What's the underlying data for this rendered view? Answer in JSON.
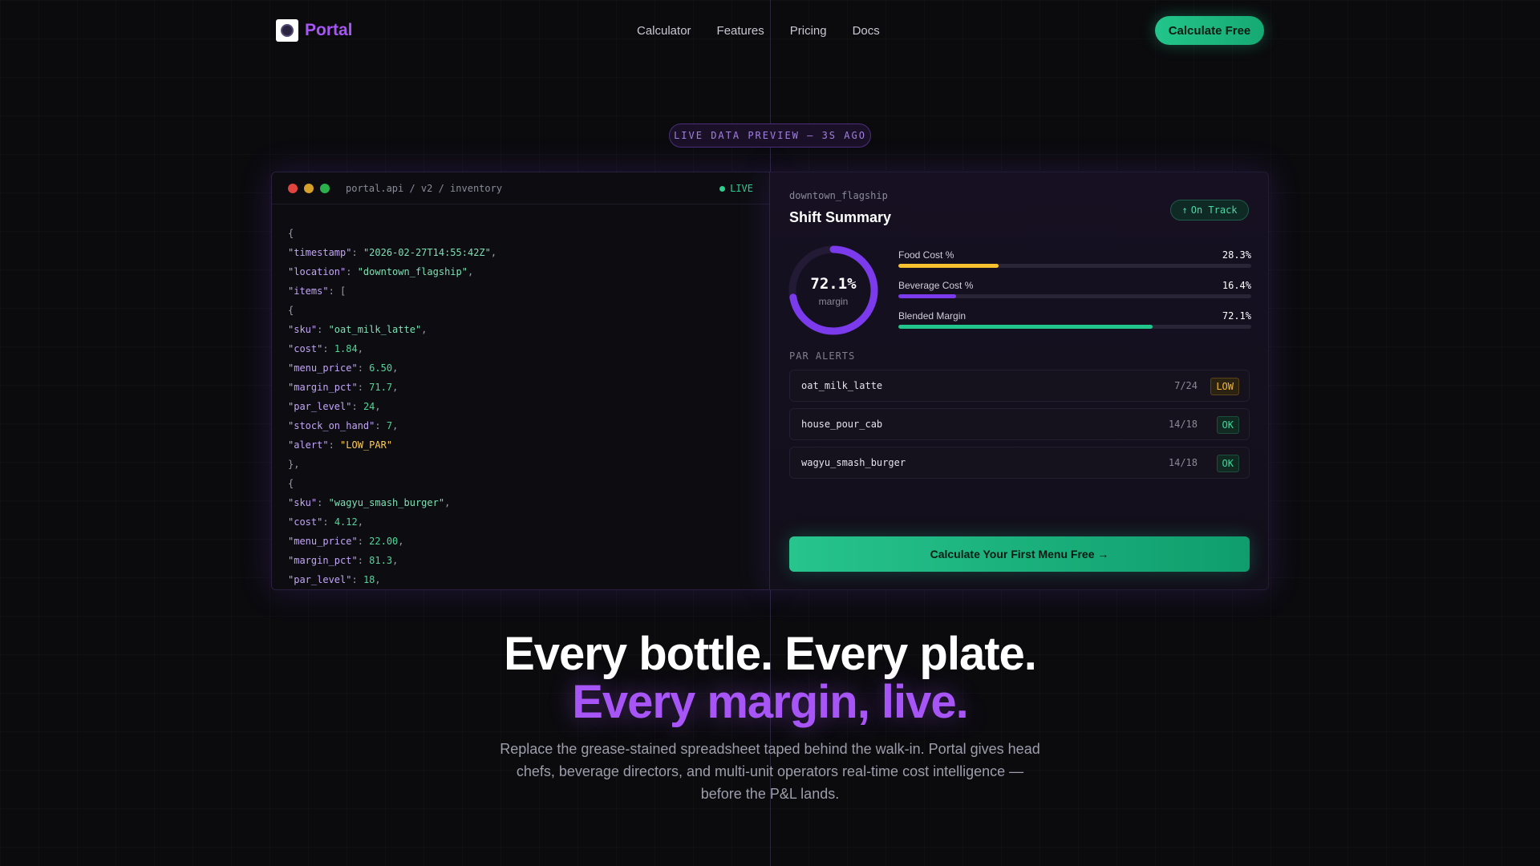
{
  "brand": {
    "name": "Portal"
  },
  "nav": {
    "links": [
      "Calculator",
      "Features",
      "Pricing",
      "Docs"
    ],
    "cta": "Calculate Free"
  },
  "badge": "LIVE DATA PREVIEW — 3S AGO",
  "code_panel": {
    "path": "portal.api / v2 / inventory",
    "live_label": "LIVE",
    "lines": {
      "open": "{",
      "timestamp_key": "\"timestamp\"",
      "timestamp_val": "\"2026-02-27T14:55:42Z\"",
      "location_key": "\"location\"",
      "location_val": "\"downtown_flagship\"",
      "items_key": "\"items\"",
      "item1": {
        "sku": "\"oat_milk_latte\"",
        "cost": "1.84",
        "menu_price": "6.50",
        "margin_pct": "71.7",
        "par_level": "24",
        "stock_on_hand": "7",
        "alert": "\"LOW_PAR\""
      },
      "item2": {
        "sku": "\"wagyu_smash_burger\"",
        "cost": "4.12",
        "menu_price": "22.00",
        "margin_pct": "81.3",
        "par_level": "18"
      }
    }
  },
  "summary": {
    "location": "downtown_flagship",
    "title": "Shift Summary",
    "status": "On Track",
    "status_icon": "arrow-up-icon",
    "ring": {
      "value_label": "72.1%",
      "value": 72.1,
      "label": "margin",
      "color": "#7c3aed"
    },
    "metrics": [
      {
        "label": "Food Cost %",
        "value_label": "28.3%",
        "value": 28.3,
        "color": "#f5c12e"
      },
      {
        "label": "Beverage Cost %",
        "value_label": "16.4%",
        "value": 16.4,
        "color": "#7c3aed"
      },
      {
        "label": "Blended Margin",
        "value_label": "72.1%",
        "value": 72.1,
        "color": "#22c58b"
      }
    ],
    "par_title": "PAR ALERTS",
    "alerts": [
      {
        "sku": "oat_milk_latte",
        "count": "7/24",
        "status": "LOW"
      },
      {
        "sku": "house_pour_cab",
        "count": "14/18",
        "status": "OK"
      },
      {
        "sku": "wagyu_smash_burger",
        "count": "14/18",
        "status": "OK"
      }
    ],
    "cta": "Calculate Your First Menu Free →"
  },
  "hero": {
    "line1": "Every bottle. Every plate.",
    "line2": "Every margin, live.",
    "subtitle": "Replace the grease-stained spreadsheet taped behind the walk-in. Portal gives head chefs, beverage directors, and multi-unit operators real-time cost intelligence — before the P&L lands."
  },
  "colors": {
    "accent": "#a855f7",
    "cta": "#22c58b"
  }
}
